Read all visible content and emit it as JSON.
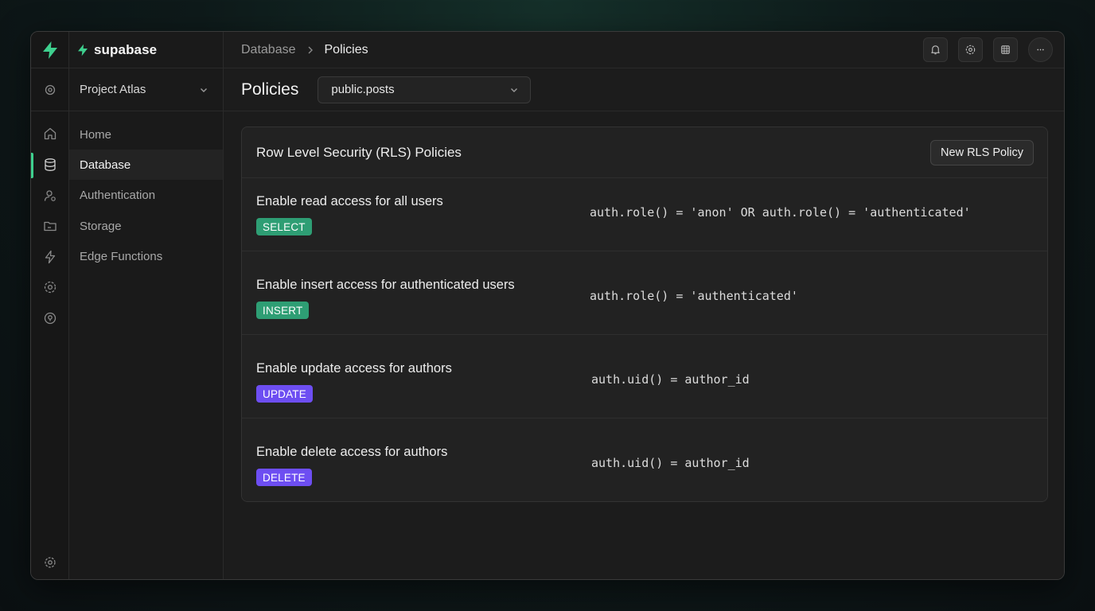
{
  "brand": {
    "name": "supabase"
  },
  "sidebar": {
    "project": "Project Atlas",
    "items": [
      {
        "label": "Home",
        "icon": "home-icon"
      },
      {
        "label": "Database",
        "icon": "database-icon",
        "active": true
      },
      {
        "label": "Authentication",
        "icon": "user-icon"
      },
      {
        "label": "Storage",
        "icon": "folder-icon"
      },
      {
        "label": "Edge Functions",
        "icon": "edge-functions-icon"
      }
    ]
  },
  "breadcrumb": {
    "parent": "Database",
    "current": "Policies"
  },
  "page": {
    "title": "Policies",
    "table_select": "public.posts"
  },
  "card": {
    "title": "Row Level Security (RLS) Policies",
    "new_button": "New RLS Policy",
    "policies": [
      {
        "name": "Enable read access for all users",
        "command": "SELECT",
        "expression": "auth.role() = 'anon' OR auth.role() = 'authenticated'"
      },
      {
        "name": "Enable insert access for authenticated users",
        "command": "INSERT",
        "expression": "auth.role() = 'authenticated'"
      },
      {
        "name": "Enable update access for authors",
        "command": "UPDATE",
        "expression": "auth.uid() = author_id"
      },
      {
        "name": "Enable delete access for authors",
        "command": "DELETE",
        "expression": "auth.uid() = author_id"
      }
    ]
  },
  "colors": {
    "accent": "#3ecf8e",
    "select_badge": "#2e9e74",
    "update_badge": "#6d4ef2",
    "background": "#1c1c1c"
  }
}
